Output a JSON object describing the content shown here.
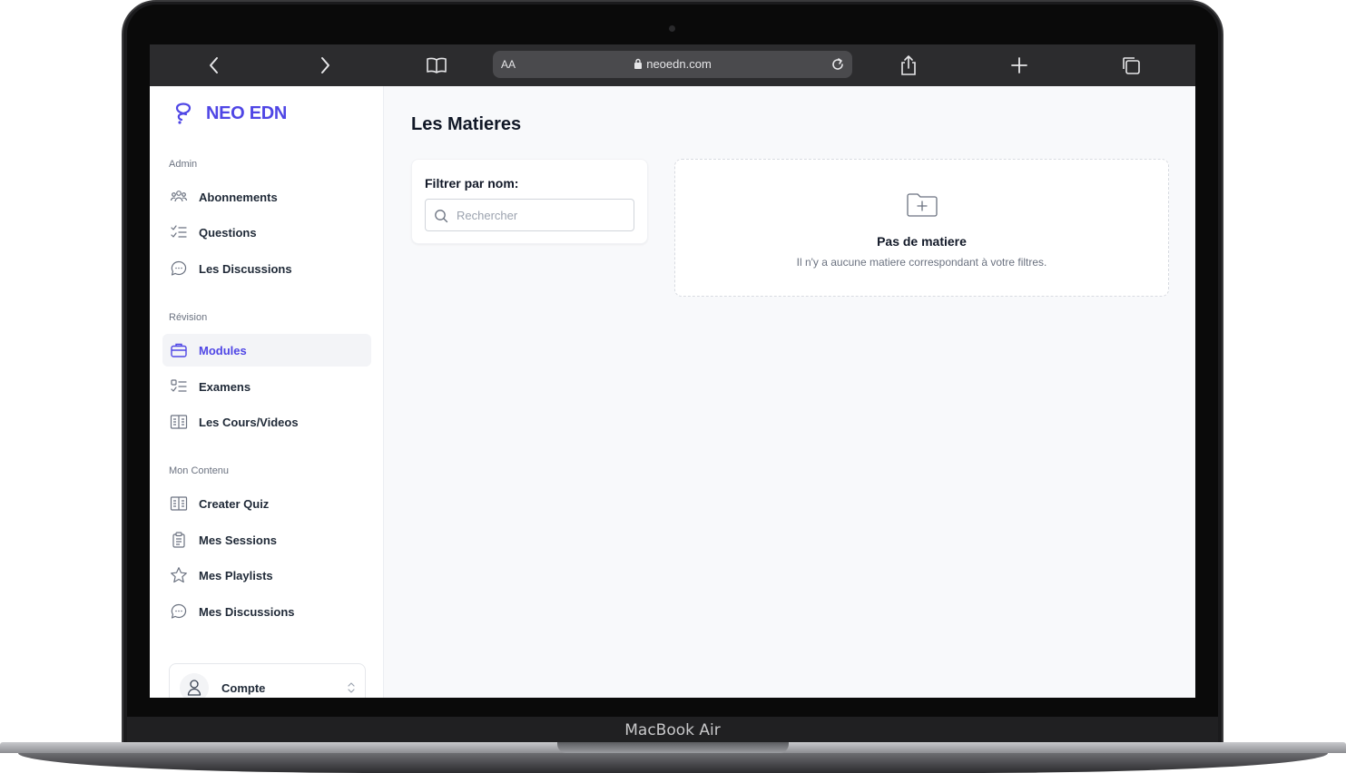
{
  "device": {
    "label": "MacBook Air"
  },
  "browser": {
    "url_aa": "AA",
    "url": "neoedn.com"
  },
  "brand": {
    "name": "NEO EDN",
    "color": "#4f46e5"
  },
  "sidebar": {
    "sections": [
      {
        "label": "Admin",
        "items": [
          {
            "label": "Abonnements",
            "icon": "users-icon"
          },
          {
            "label": "Questions",
            "icon": "checklist-icon"
          },
          {
            "label": "Les Discussions",
            "icon": "chat-bubble-icon"
          }
        ]
      },
      {
        "label": "Révision",
        "items": [
          {
            "label": "Modules",
            "icon": "briefcase-icon",
            "active": true
          },
          {
            "label": "Examens",
            "icon": "list-check-icon"
          },
          {
            "label": "Les Cours/Videos",
            "icon": "book-open-icon"
          }
        ]
      },
      {
        "label": "Mon Contenu",
        "items": [
          {
            "label": "Creater Quiz",
            "icon": "book-open-icon"
          },
          {
            "label": "Mes Sessions",
            "icon": "clipboard-icon"
          },
          {
            "label": "Mes Playlists",
            "icon": "star-icon"
          },
          {
            "label": "Mes Discussions",
            "icon": "chat-bubble-icon"
          }
        ]
      }
    ],
    "account": {
      "label": "Compte"
    }
  },
  "main": {
    "title": "Les Matieres",
    "filter": {
      "label": "Filtrer par nom:",
      "placeholder": "Rechercher"
    },
    "empty": {
      "title": "Pas de matiere",
      "subtitle": "Il n'y a aucune matiere correspondant à votre filtres."
    }
  }
}
